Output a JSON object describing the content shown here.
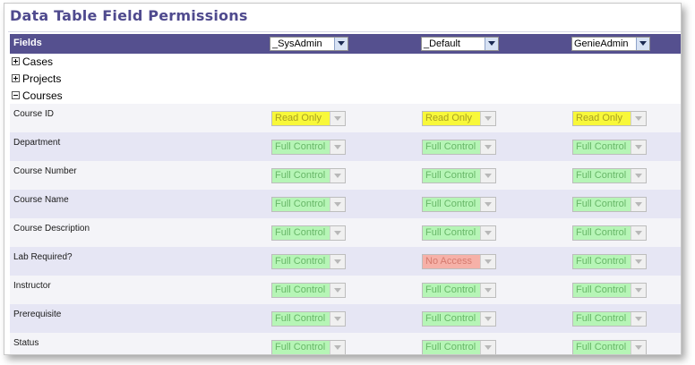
{
  "page": {
    "title": "Data Table Field Permissions"
  },
  "header": {
    "fields_label": "Fields",
    "role_selects": [
      {
        "value": "_SysAdmin"
      },
      {
        "value": "_Default"
      },
      {
        "value": "GenieAdmin"
      }
    ]
  },
  "tree": [
    {
      "label": "Cases",
      "expanded": false
    },
    {
      "label": "Projects",
      "expanded": false
    },
    {
      "label": "Courses",
      "expanded": true
    }
  ],
  "fields": [
    {
      "name": "Course ID",
      "permissions": [
        "Read Only",
        "Read Only",
        "Read Only"
      ]
    },
    {
      "name": "Department",
      "permissions": [
        "Full Control",
        "Full Control",
        "Full Control"
      ]
    },
    {
      "name": "Course Number",
      "permissions": [
        "Full Control",
        "Full Control",
        "Full Control"
      ]
    },
    {
      "name": "Course Name",
      "permissions": [
        "Full Control",
        "Full Control",
        "Full Control"
      ]
    },
    {
      "name": "Course Description",
      "permissions": [
        "Full Control",
        "Full Control",
        "Full Control"
      ]
    },
    {
      "name": "Lab Required?",
      "permissions": [
        "Full Control",
        "No Access",
        "Full Control"
      ]
    },
    {
      "name": "Instructor",
      "permissions": [
        "Full Control",
        "Full Control",
        "Full Control"
      ]
    },
    {
      "name": "Prerequisite",
      "permissions": [
        "Full Control",
        "Full Control",
        "Full Control"
      ]
    },
    {
      "name": "Status",
      "permissions": [
        "Full Control",
        "Full Control",
        "Full Control"
      ]
    }
  ],
  "colors": {
    "header_bar": "#55508f",
    "title": "#4f4a8e",
    "full_control": "#b6f5b6",
    "read_only": "#f8f83a",
    "no_access": "#f6b1a8"
  }
}
